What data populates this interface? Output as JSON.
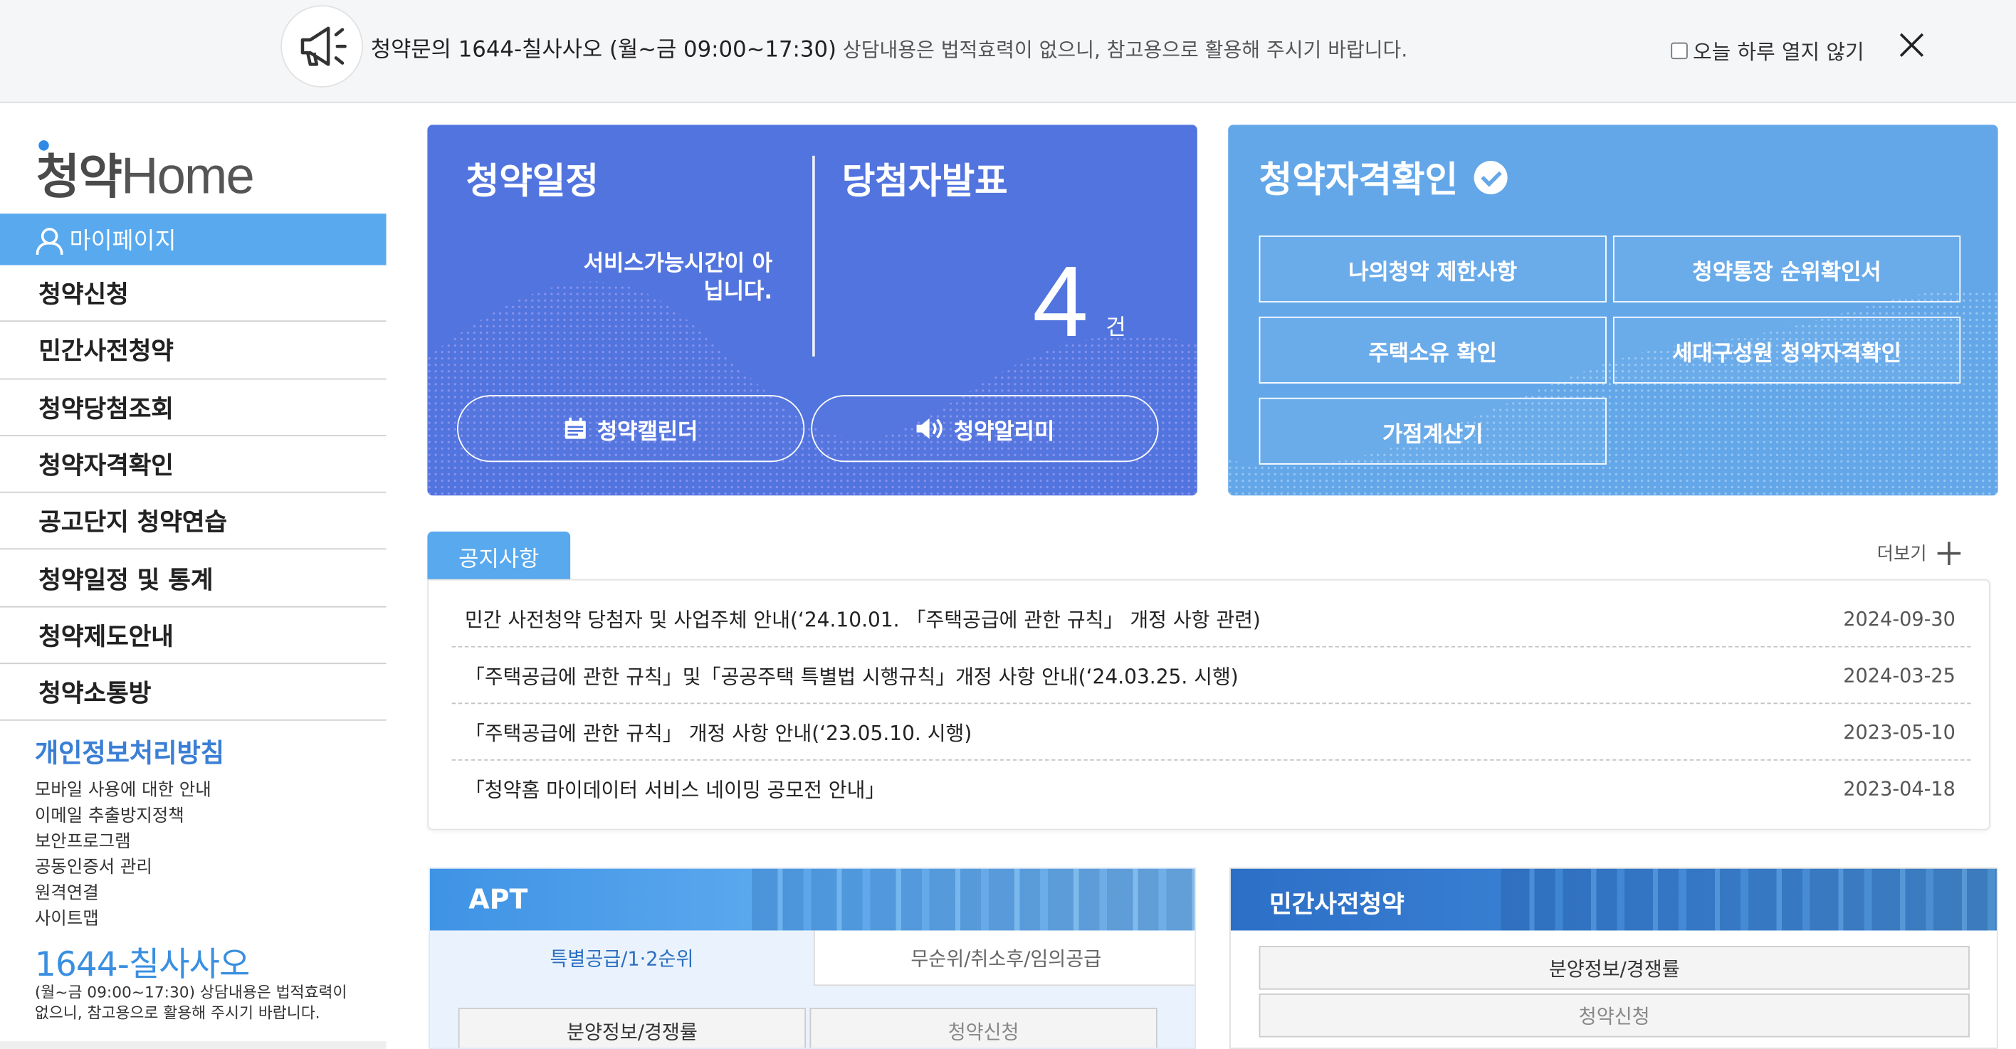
{
  "notice": {
    "lead": "청약문의 1644-칠사사오 (월~금 09:00~17:30)",
    "rest": " 상담내용은 법적효력이 없으니, 참고용으로 활용해 주시기 바랍니다.",
    "dont_show_today": "오늘 하루 열지 않기"
  },
  "sidebar": {
    "logo_kr": "청약",
    "logo_en": "Home",
    "mypage": "마이페이지",
    "items": [
      {
        "label": "청약신청"
      },
      {
        "label": "민간사전청약"
      },
      {
        "label": "청약당첨조회"
      },
      {
        "label": "청약자격확인"
      },
      {
        "label": "공고단지 청약연습"
      },
      {
        "label": "청약일정 및 통계"
      },
      {
        "label": "청약제도안내"
      },
      {
        "label": "청약소통방"
      }
    ],
    "privacy": "개인정보처리방침",
    "links": [
      "모바일 사용에 대한 안내",
      "이메일 추출방지정책",
      "보안프로그램",
      "공동인증서 관리",
      "원격연결",
      "사이트맵"
    ],
    "phone": "1644-칠사사오",
    "phone_desc": "(월~금 09:00~17:30) 상담내용은 법적효력이 없으니, 참고용으로 활용해 주시기 바랍니다."
  },
  "schedule_card": {
    "title": "청약일정",
    "status": "서비스가능시간이 아닙니다.",
    "winners_title": "당첨자발표",
    "count": "4",
    "unit": "건",
    "calendar_btn": "청약캘린더",
    "alarm_btn": "청약알리미"
  },
  "qualify_card": {
    "title": "청약자격확인",
    "buttons": [
      "나의청약 제한사항",
      "청약통장 순위확인서",
      "주택소유 확인",
      "세대구성원 청약자격확인",
      "가점계산기"
    ]
  },
  "board": {
    "tab": "공지사항",
    "more": "더보기",
    "rows": [
      {
        "title": "민간 사전청약 당첨자 및 사업주체 안내(‘24.10.01. 「주택공급에 관한 규칙」 개정 사항 관련)",
        "date": "2024-09-30"
      },
      {
        "title": "「주택공급에 관한 규칙」및「공공주택 특별법 시행규칙」개정 사항 안내(‘24.03.25. 시행)",
        "date": "2024-03-25"
      },
      {
        "title": "「주택공급에 관한 규칙」 개정 사항 안내(‘23.05.10. 시행)",
        "date": "2023-05-10"
      },
      {
        "title": "「청약홈 마이데이터 서비스 네이밍 공모전 안내」",
        "date": "2023-04-18"
      }
    ]
  },
  "apt": {
    "title": "APT",
    "tab_on": "특별공급/1·2순위",
    "tab_off": "무순위/취소후/임의공급",
    "btn1": "분양정보/경쟁률",
    "btn2": "청약신청"
  },
  "private": {
    "title": "민간사전청약",
    "btn1": "분양정보/경쟁률",
    "btn2": "청약신청"
  },
  "colors": {
    "accent": "#58a9ee",
    "schedule_card": "#5274de",
    "qualify_card": "#63a7e9"
  }
}
